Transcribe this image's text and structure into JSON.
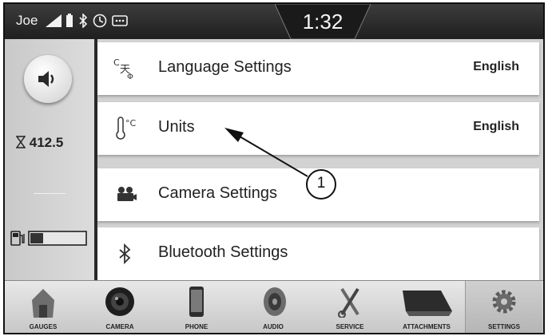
{
  "status": {
    "user": "Joe",
    "time": "1:32",
    "icons": [
      "signal-icon",
      "battery-icon",
      "bluetooth-icon",
      "clock-icon",
      "message-icon"
    ]
  },
  "left_panel": {
    "volume_icon": "speaker-icon",
    "hours": "412.5",
    "hours_icon": "hourglass-icon",
    "fuel_icon": "fuel-pump-icon"
  },
  "settings": [
    {
      "icon": "language-icon",
      "label": "Language Settings",
      "value": "English"
    },
    {
      "icon": "thermometer-icon",
      "label": "Units",
      "value": "English"
    },
    {
      "icon": "camera-icon",
      "label": "Camera Settings",
      "value": ""
    },
    {
      "icon": "bluetooth-icon",
      "label": "Bluetooth Settings",
      "value": ""
    }
  ],
  "nav": [
    {
      "icon": "barn-icon",
      "label": "GAUGES"
    },
    {
      "icon": "camera-lens-icon",
      "label": "CAMERA"
    },
    {
      "icon": "phone-icon",
      "label": "PHONE"
    },
    {
      "icon": "speaker-icon",
      "label": "AUDIO"
    },
    {
      "icon": "wrench-icon",
      "label": "SERVICE"
    },
    {
      "icon": "bucket-icon",
      "label": "ATTACHMENTS"
    },
    {
      "icon": "gear-icon",
      "label": "SETTINGS",
      "active": true
    }
  ],
  "callout": {
    "number": "1"
  },
  "colors": {
    "status_bar": "#2a2a2a",
    "list_background": "#d2d2d2",
    "row_background": "#ffffff",
    "active_tab": "#b5b5b5"
  }
}
